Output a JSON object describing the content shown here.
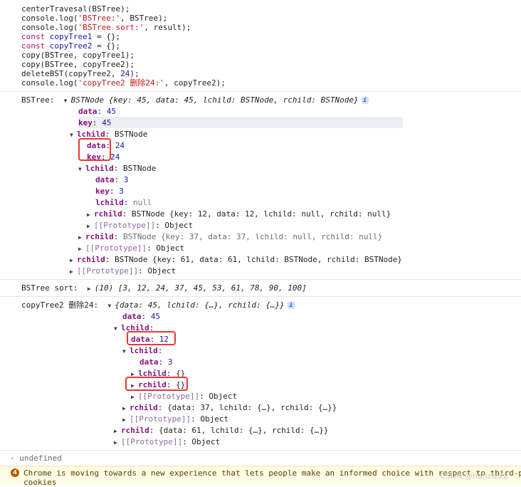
{
  "code": {
    "l1": "centerTravesal(BSTree);",
    "l2a": "console.log(",
    "l2s": "'BSTree:'",
    "l2b": ", BSTree);",
    "l3a": "console.log(",
    "l3s": "'BSTree sort:'",
    "l3b": ", result);",
    "l4k": "const",
    "l4v": "copyTree1",
    "l4b": " = {};",
    "l5k": "const",
    "l5v": "copyTree2",
    "l5b": " = {};",
    "l6": "copy(BSTree, copyTree1);",
    "l7": "copy(BSTree, copyTree2);",
    "l8a": "deleteBST(copyTree2, ",
    "l8n": "24",
    "l8b": ");",
    "l9a": "console.log(",
    "l9s": "'copyTree2 删除24:'",
    "l9b": ", copyTree2);"
  },
  "log1": {
    "label": "BSTree:",
    "summary": "BSTNode {key: 45, data: 45, lchild: BSTNode, rchild: BSTNode}",
    "info": "i",
    "rows": [
      {
        "k": "data",
        "v": "45"
      },
      {
        "k": "key",
        "v": "45"
      },
      {
        "k": "lchild",
        "v": "BSTNode"
      },
      {
        "k": "data",
        "v": "24"
      },
      {
        "k": "key",
        "v": "24"
      },
      {
        "k": "lchild",
        "v": "BSTNode"
      },
      {
        "k": "data",
        "v": "3"
      },
      {
        "k": "key",
        "v": "3"
      },
      {
        "k": "lchild",
        "v": "null"
      },
      {
        "k": "rchild",
        "v": "BSTNode {key: 12, data: 12, lchild: null, rchild: null}"
      },
      {
        "k": "[[Prototype]]",
        "v": "Object"
      },
      {
        "k": "rchild",
        "v": "BSTNode {key: 37, data: 37, lchild: null, rchild: null}"
      },
      {
        "k": "[[Prototype]]",
        "v": "Object"
      },
      {
        "k": "rchild",
        "v": "BSTNode {key: 61, data: 61, lchild: BSTNode, rchild: BSTNode}"
      },
      {
        "k": "[[Prototype]]",
        "v": "Object"
      }
    ]
  },
  "log2": {
    "label": "BSTree sort:",
    "summary": "(10) [3, 12, 24, 37, 45, 53, 61, 78, 90, 100]"
  },
  "log3": {
    "label": "copyTree2 删除24:",
    "summary": "{data: 45, lchild: {…}, rchild: {…}}",
    "info": "i",
    "rows": [
      {
        "k": "data",
        "v": "45"
      },
      {
        "k": "lchild",
        "v": ""
      },
      {
        "k": "data",
        "v": "12"
      },
      {
        "k": "lchild",
        "v": ""
      },
      {
        "k": "data",
        "v": "3"
      },
      {
        "k": "lchild",
        "v": "{}"
      },
      {
        "k": "rchild",
        "v": "{}"
      },
      {
        "k": "[[Prototype]]",
        "v": "Object"
      },
      {
        "k": "rchild",
        "v": "{data: 37, lchild: {…}, rchild: {…}}"
      },
      {
        "k": "[[Prototype]]",
        "v": "Object"
      },
      {
        "k": "rchild",
        "v": "{data: 61, lchild: {…}, rchild: {…}}"
      },
      {
        "k": "[[Prototype]]",
        "v": "Object"
      }
    ]
  },
  "result": {
    "text": "undefined"
  },
  "warning": {
    "count": "4",
    "text": "Chrome is moving towards a new experience that lets people make an informed choice with respect to third-p",
    "text2": "cookies"
  },
  "watermark": {
    "text": "CSDN @hanzi222"
  },
  "colors": {
    "highlight_box": "#e53935",
    "selected_row": "#eceef1"
  }
}
